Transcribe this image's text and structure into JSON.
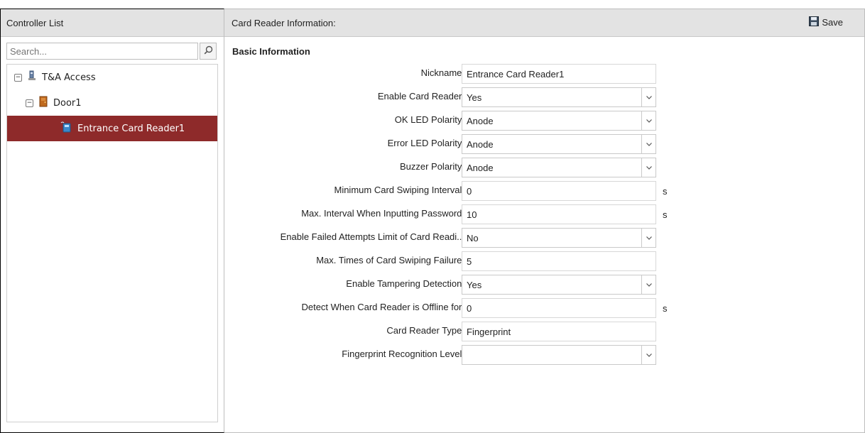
{
  "controller_panel": {
    "title": "Controller List",
    "search": {
      "placeholder": "Search..."
    },
    "tree": [
      {
        "label": "T&A Access",
        "icon": "access-control-icon",
        "toggle": "−"
      },
      {
        "label": "Door1",
        "icon": "door-icon",
        "toggle": "−"
      },
      {
        "label": "Entrance Card Reader1",
        "icon": "card-reader-icon",
        "selected": true
      }
    ]
  },
  "main_panel": {
    "title": "Card Reader Information:",
    "save_label": "Save",
    "section_title": "Basic Information",
    "fields": [
      {
        "label": "Nickname:",
        "value": "Entrance Card Reader1",
        "type": "text"
      },
      {
        "label": "Enable Card Reader:",
        "value": "Yes",
        "type": "select"
      },
      {
        "label": "OK LED Polarity:",
        "value": "Anode",
        "type": "select"
      },
      {
        "label": "Error LED Polarity:",
        "value": "Anode",
        "type": "select"
      },
      {
        "label": "Buzzer Polarity:",
        "value": "Anode",
        "type": "select"
      },
      {
        "label": "Minimum Card Swiping Interval:",
        "value": "0",
        "type": "text",
        "unit": "s"
      },
      {
        "label": "Max. Interval When Inputting Password:",
        "value": "10",
        "type": "text",
        "unit": "s"
      },
      {
        "label": "Enable Failed Attempts Limit of Card Readi...",
        "value": "No",
        "type": "select"
      },
      {
        "label": "Max. Times of Card Swiping Failure:",
        "value": "5",
        "type": "text"
      },
      {
        "label": "Enable Tampering Detection:",
        "value": "Yes",
        "type": "select"
      },
      {
        "label": "Detect When Card Reader is Offline for:",
        "value": "0",
        "type": "text",
        "unit": "s"
      },
      {
        "label": "Card Reader Type:",
        "value": "Fingerprint",
        "type": "text"
      },
      {
        "label": "Fingerprint Recognition Level:",
        "value": "",
        "type": "select"
      }
    ]
  },
  "colors": {
    "header_bg": "#e3e3e3",
    "selected_row_bg": "#8e2a2a",
    "selected_row_text": "#ffffff"
  }
}
